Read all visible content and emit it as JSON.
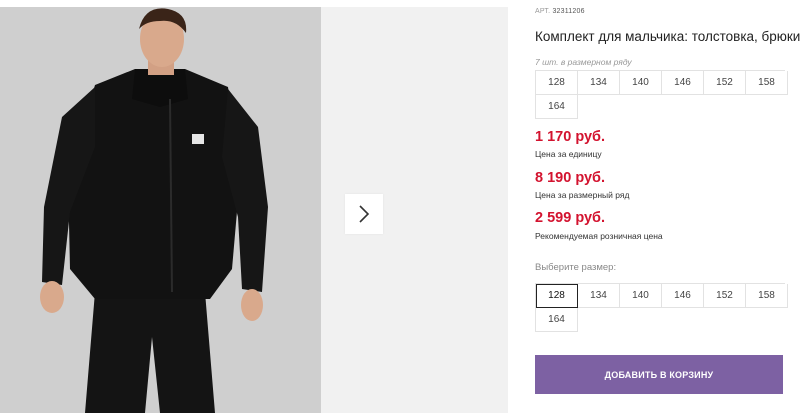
{
  "product": {
    "sku_label": "АРТ.",
    "sku_number": "32311206",
    "title": "Комплект для мальчика: толстовка, брюки"
  },
  "size_grid": {
    "caption": "7 шт. в размерном ряду",
    "sizes": [
      "128",
      "134",
      "140",
      "146",
      "152",
      "158",
      "164"
    ]
  },
  "prices": {
    "unit_price": "1 170 руб.",
    "unit_label": "Цена за единицу",
    "set_price": "8 190 руб.",
    "set_label": "Цена за размерный ряд",
    "rrp_price": "2 599 руб.",
    "rrp_label": "Рекомендуемая розничная цена"
  },
  "size_select": {
    "label": "Выберите размер:",
    "sizes": [
      "128",
      "134",
      "140",
      "146",
      "152",
      "158",
      "164"
    ],
    "selected": "128"
  },
  "cart": {
    "add_label": "ДОБАВИТЬ В КОРЗИНУ"
  },
  "colors": {
    "price_red": "#d3132f",
    "button_purple": "#7d61a3"
  },
  "icons": {
    "next": "chevron-right-icon"
  }
}
